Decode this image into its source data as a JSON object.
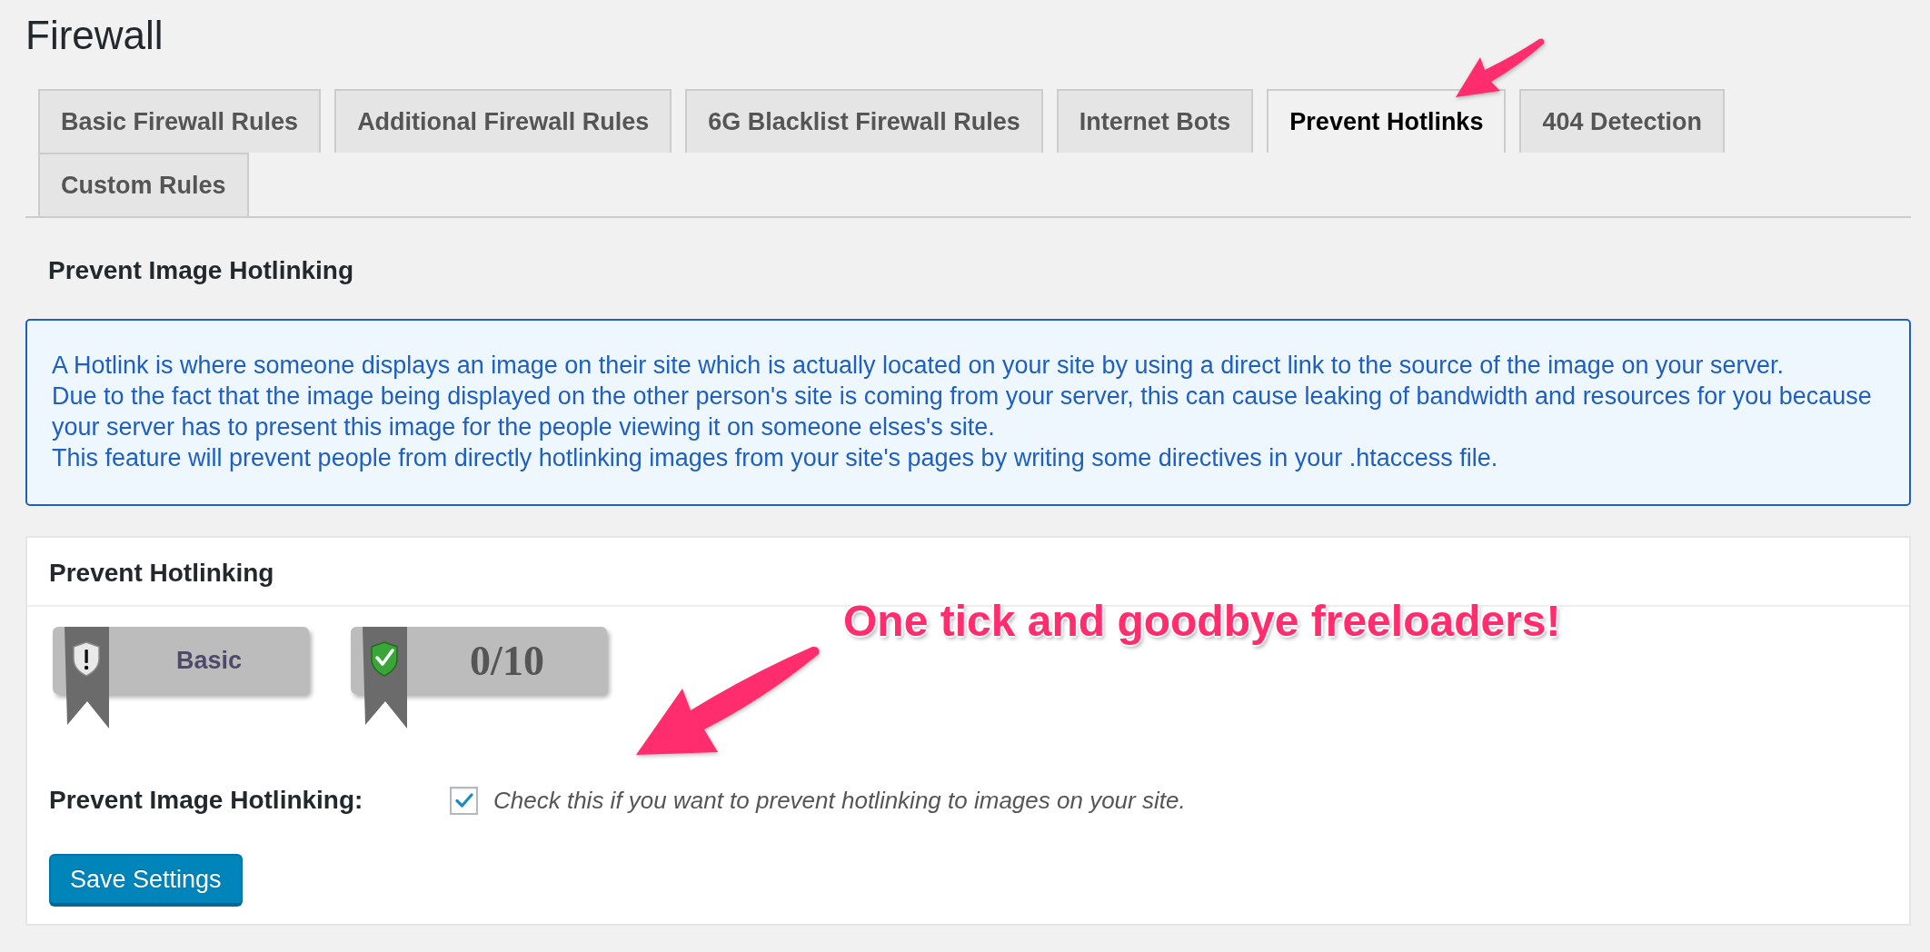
{
  "page": {
    "title": "Firewall"
  },
  "tabs": [
    {
      "label": "Basic Firewall Rules",
      "selected": false
    },
    {
      "label": "Additional Firewall Rules",
      "selected": false
    },
    {
      "label": "6G Blacklist Firewall Rules",
      "selected": false
    },
    {
      "label": "Internet Bots",
      "selected": false
    },
    {
      "label": "Prevent Hotlinks",
      "selected": true
    },
    {
      "label": "404 Detection",
      "selected": false
    },
    {
      "label": "Custom Rules",
      "selected": false
    }
  ],
  "section": {
    "title": "Prevent Image Hotlinking",
    "info_box": {
      "paragraphs": [
        "A Hotlink is where someone displays an image on their site which is actually located on your site by using a direct link to the source of the image on your server.",
        "Due to the fact that the image being displayed on the other person's site is coming from your server, this can cause leaking of bandwidth and resources for you because your server has to present this image for the people viewing it on someone elses's site.",
        "This feature will prevent people from directly hotlinking images from your site's pages by writing some directives in your .htaccess file."
      ]
    }
  },
  "settings_box": {
    "title": "Prevent Hotlinking",
    "badges": [
      {
        "kind": "level",
        "text": "Basic"
      },
      {
        "kind": "score",
        "text": "0/10"
      }
    ],
    "fields": [
      {
        "kind": "checkbox",
        "label": "Prevent Image Hotlinking:",
        "checked": true,
        "description": "Check this if you want to prevent hotlinking to images on your site."
      }
    ],
    "save_button": {
      "label": "Save Settings"
    }
  },
  "annotation": {
    "callout": "One tick and goodbye freeloaders!"
  }
}
